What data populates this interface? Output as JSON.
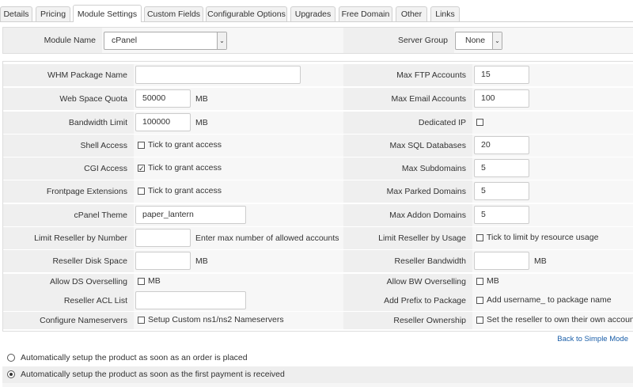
{
  "tabs": [
    "Details",
    "Pricing",
    "Module Settings",
    "Custom Fields",
    "Configurable Options",
    "Upgrades",
    "Free Domain",
    "Other",
    "Links"
  ],
  "active_tab": "Module Settings",
  "module": {
    "name_label": "Module Name",
    "name_value": "cPanel",
    "server_group_label": "Server Group",
    "server_group_value": "None"
  },
  "left": {
    "whm_package_name": {
      "label": "WHM Package Name",
      "value": ""
    },
    "web_space_quota": {
      "label": "Web Space Quota",
      "value": "50000",
      "unit": "MB"
    },
    "bandwidth_limit": {
      "label": "Bandwidth Limit",
      "value": "100000",
      "unit": "MB"
    },
    "shell_access": {
      "label": "Shell Access",
      "checked": false,
      "text": "Tick to grant access"
    },
    "cgi_access": {
      "label": "CGI Access",
      "checked": true,
      "text": "Tick to grant access"
    },
    "frontpage_extensions": {
      "label": "Frontpage Extensions",
      "checked": false,
      "text": "Tick to grant access"
    },
    "cpanel_theme": {
      "label": "cPanel Theme",
      "value": "paper_lantern"
    },
    "limit_reseller_by_number": {
      "label": "Limit Reseller by Number",
      "value": "",
      "hint": "Enter max number of allowed accounts"
    },
    "reseller_disk_space": {
      "label": "Reseller Disk Space",
      "value": "",
      "unit": "MB"
    },
    "allow_ds_overselling": {
      "label": "Allow DS Overselling",
      "checked": false,
      "text": "MB"
    },
    "reseller_acl_list": {
      "label": "Reseller ACL List",
      "value": ""
    },
    "configure_nameservers": {
      "label": "Configure Nameservers",
      "checked": false,
      "text": "Setup Custom ns1/ns2 Nameservers"
    }
  },
  "right": {
    "max_ftp_accounts": {
      "label": "Max FTP Accounts",
      "value": "15"
    },
    "max_email_accounts": {
      "label": "Max Email Accounts",
      "value": "100"
    },
    "dedicated_ip": {
      "label": "Dedicated IP",
      "checked": false
    },
    "max_sql_databases": {
      "label": "Max SQL Databases",
      "value": "20"
    },
    "max_subdomains": {
      "label": "Max Subdomains",
      "value": "5"
    },
    "max_parked_domains": {
      "label": "Max Parked Domains",
      "value": "5"
    },
    "max_addon_domains": {
      "label": "Max Addon Domains",
      "value": "5"
    },
    "limit_reseller_by_usage": {
      "label": "Limit Reseller by Usage",
      "checked": false,
      "text": "Tick to limit by resource usage"
    },
    "reseller_bandwidth": {
      "label": "Reseller Bandwidth",
      "value": "",
      "unit": "MB"
    },
    "allow_bw_overselling": {
      "label": "Allow BW Overselling",
      "checked": false,
      "text": "MB"
    },
    "add_prefix_to_package": {
      "label": "Add Prefix to Package",
      "checked": false,
      "text": "Add username_ to package name"
    },
    "reseller_ownership": {
      "label": "Reseller Ownership",
      "checked": false,
      "text": "Set the reseller to own their own accounts"
    }
  },
  "back_to_simple_mode": "Back to Simple Mode",
  "setup_options": [
    {
      "text": "Automatically setup the product as soon as an order is placed",
      "selected": false
    },
    {
      "text": "Automatically setup the product as soon as the first payment is received",
      "selected": true
    }
  ]
}
